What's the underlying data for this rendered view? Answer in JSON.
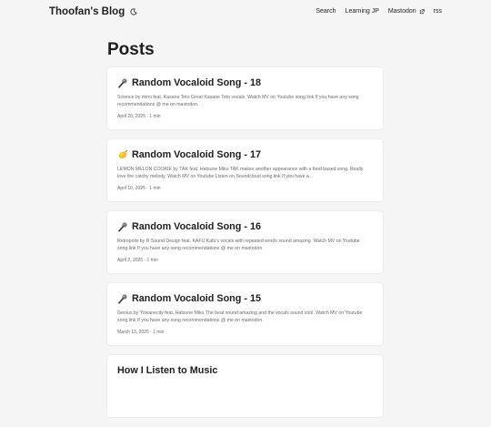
{
  "header": {
    "logo": "Thoofan's Blog",
    "nav": [
      {
        "label": "Search"
      },
      {
        "label": "Learning JP"
      },
      {
        "label": "Mastodon"
      },
      {
        "label": "rss"
      }
    ]
  },
  "main": {
    "title": "Posts",
    "posts": [
      {
        "icon": "microphone-icon",
        "title": "Random Vocaloid Song - 18",
        "excerpt": "Science by mimi feat. Kasane Teto Great Kasane Teto vocals. Watch MV on Youtube song.link If you have any song recommendations @ me on mastodon.",
        "meta": "April 20, 2025 · 1 min"
      },
      {
        "icon": "lemon-icon",
        "title": "Random Vocaloid Song - 17",
        "excerpt": "LEMON MELON COOKIE by TAK feat. Hatsune Miku TAK makes another appearance with a food based song. Really love the catchy melody. Watch MV on Youtube Listen on Soundcloud song.link If you have a...",
        "meta": "April 10, 2025 · 1 min"
      },
      {
        "icon": "microphone-icon",
        "title": "Random Vocaloid Song - 16",
        "excerpt": "Retropolis by R Sound Design feat. KAFU Kafu's vocals with repeated words sound amazing. Watch MV on Youtube song.link If you have any song recommendations @ me on mastodon.",
        "meta": "April 2, 2025 · 1 min"
      },
      {
        "icon": "microphone-icon",
        "title": "Random Vocaloid Song - 15",
        "excerpt": "Genius by Yowanecity feat. Hatsune Miku The beat sound amazing and the vocals sound cool. Watch MV on Youtube song.link If you have any song recommendations @ me on mastodon.",
        "meta": "March 13, 2025 · 1 min"
      },
      {
        "icon": "",
        "title": "How I Listen to Music",
        "excerpt": "",
        "meta": ""
      }
    ]
  }
}
